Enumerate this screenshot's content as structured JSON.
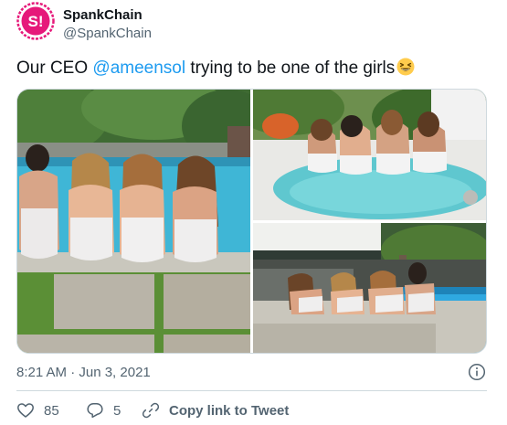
{
  "author": {
    "name": "SpankChain",
    "handle": "@SpankChain",
    "avatar_text": "S!"
  },
  "tweet": {
    "text_before": "Our CEO ",
    "mention": "@ameensol",
    "text_after": " trying to be one of the girls",
    "emoji": "grinning-squinting-face"
  },
  "timestamp": "8:21 AM · Jun 3, 2021",
  "actions": {
    "likes": "85",
    "replies": "5",
    "copy_link": "Copy link to Tweet"
  },
  "colors": {
    "accent": "#1d9bf0",
    "brand": "#e6197a",
    "secondary_text": "#536471"
  },
  "icons": [
    "heart-icon",
    "reply-icon",
    "link-icon",
    "info-icon"
  ]
}
